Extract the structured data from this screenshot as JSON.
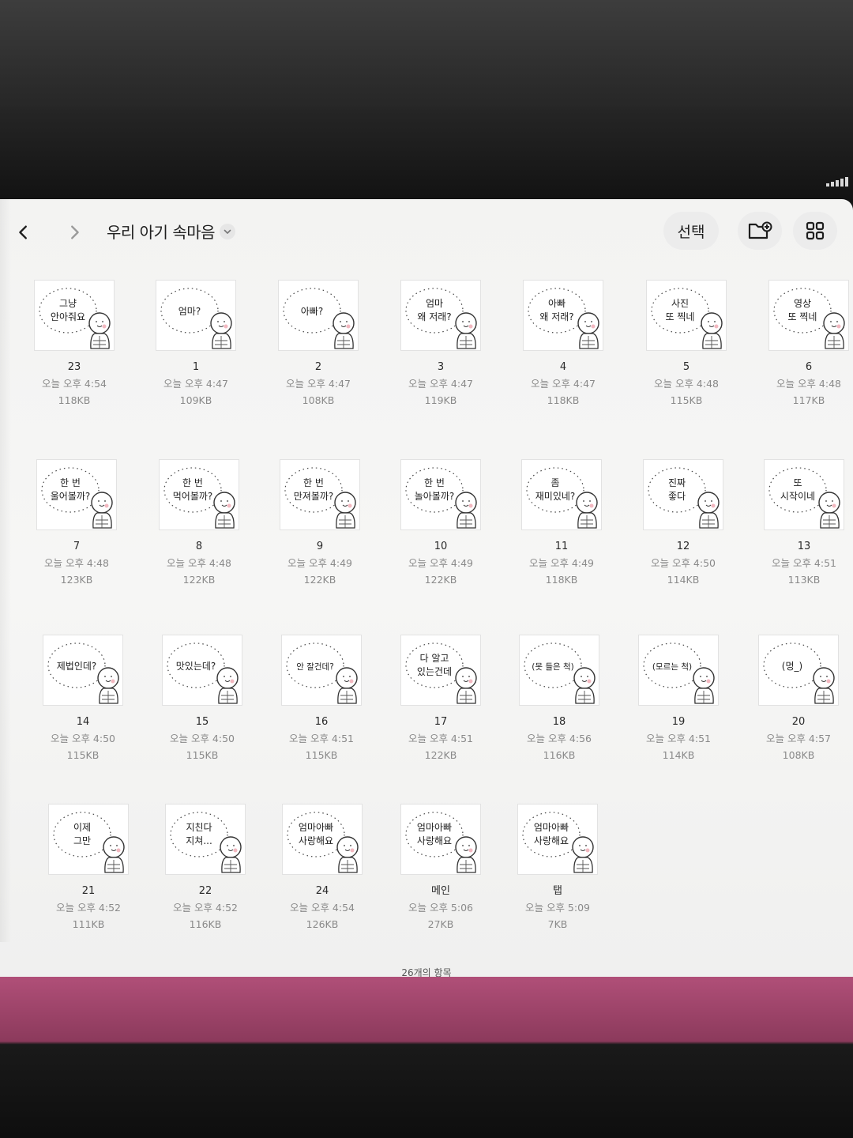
{
  "window": {
    "title": "우리 아기 속마음"
  },
  "toolbar": {
    "select_label": "선택"
  },
  "icons": {
    "back": "chevron-left-icon",
    "forward": "chevron-right-icon",
    "title_menu": "chevron-down-icon",
    "new_folder": "folder-plus-icon",
    "view_mode": "grid-view-icon",
    "signal": "signal-strength-icon"
  },
  "files": [
    {
      "name": "23",
      "date": "오늘 오후 4:54",
      "size": "118KB",
      "bubble": [
        "그냥",
        "안아줘요"
      ]
    },
    {
      "name": "1",
      "date": "오늘 오후 4:47",
      "size": "109KB",
      "bubble": [
        "엄마?"
      ]
    },
    {
      "name": "2",
      "date": "오늘 오후 4:47",
      "size": "108KB",
      "bubble": [
        "아빠?"
      ]
    },
    {
      "name": "3",
      "date": "오늘 오후 4:47",
      "size": "119KB",
      "bubble": [
        "엄마",
        "왜 저래?"
      ]
    },
    {
      "name": "4",
      "date": "오늘 오후 4:47",
      "size": "118KB",
      "bubble": [
        "아빠",
        "왜 저래?"
      ]
    },
    {
      "name": "5",
      "date": "오늘 오후 4:48",
      "size": "115KB",
      "bubble": [
        "사진",
        "또 찍네"
      ]
    },
    {
      "name": "6",
      "date": "오늘 오후 4:48",
      "size": "117KB",
      "bubble": [
        "영상",
        "또 찍네"
      ]
    },
    {
      "name": "7",
      "date": "오늘 오후 4:48",
      "size": "123KB",
      "bubble": [
        "한 번",
        "울어볼까?"
      ]
    },
    {
      "name": "8",
      "date": "오늘 오후 4:48",
      "size": "122KB",
      "bubble": [
        "한 번",
        "먹어볼까?"
      ]
    },
    {
      "name": "9",
      "date": "오늘 오후 4:49",
      "size": "122KB",
      "bubble": [
        "한 번",
        "만져볼까?"
      ]
    },
    {
      "name": "10",
      "date": "오늘 오후 4:49",
      "size": "122KB",
      "bubble": [
        "한 번",
        "놀아볼까?"
      ]
    },
    {
      "name": "11",
      "date": "오늘 오후 4:49",
      "size": "118KB",
      "bubble": [
        "좀",
        "재미있네?"
      ]
    },
    {
      "name": "12",
      "date": "오늘 오후 4:50",
      "size": "114KB",
      "bubble": [
        "진짜",
        "좋다"
      ]
    },
    {
      "name": "13",
      "date": "오늘 오후 4:51",
      "size": "113KB",
      "bubble": [
        "또",
        "시작이네"
      ]
    },
    {
      "name": "14",
      "date": "오늘 오후 4:50",
      "size": "115KB",
      "bubble": [
        "제법인데?"
      ]
    },
    {
      "name": "15",
      "date": "오늘 오후 4:50",
      "size": "115KB",
      "bubble": [
        "맛있는데?"
      ]
    },
    {
      "name": "16",
      "date": "오늘 오후 4:51",
      "size": "115KB",
      "bubble": [
        "안 잘건데?"
      ]
    },
    {
      "name": "17",
      "date": "오늘 오후 4:51",
      "size": "122KB",
      "bubble": [
        "다 알고",
        "있는건데"
      ]
    },
    {
      "name": "18",
      "date": "오늘 오후 4:56",
      "size": "116KB",
      "bubble": [
        "(못 들은 척)"
      ]
    },
    {
      "name": "19",
      "date": "오늘 오후 4:51",
      "size": "114KB",
      "bubble": [
        "(모르는 척)"
      ]
    },
    {
      "name": "20",
      "date": "오늘 오후 4:57",
      "size": "108KB",
      "bubble": [
        "(멍_)"
      ]
    },
    {
      "name": "21",
      "date": "오늘 오후 4:52",
      "size": "111KB",
      "bubble": [
        "이제",
        "그만"
      ]
    },
    {
      "name": "22",
      "date": "오늘 오후 4:52",
      "size": "116KB",
      "bubble": [
        "지친다",
        "지쳐..."
      ]
    },
    {
      "name": "24",
      "date": "오늘 오후 4:54",
      "size": "126KB",
      "bubble": [
        "엄마아빠",
        "사랑해요"
      ]
    },
    {
      "name": "메인",
      "date": "오늘 오후 5:06",
      "size": "27KB",
      "bubble": [
        "엄마아빠",
        "사랑해요"
      ]
    },
    {
      "name": "탭",
      "date": "오늘 오후 5:09",
      "size": "7KB",
      "bubble": [
        "엄마아빠",
        "사랑해요"
      ]
    }
  ],
  "footer": {
    "count_label": "26개의 항목"
  }
}
